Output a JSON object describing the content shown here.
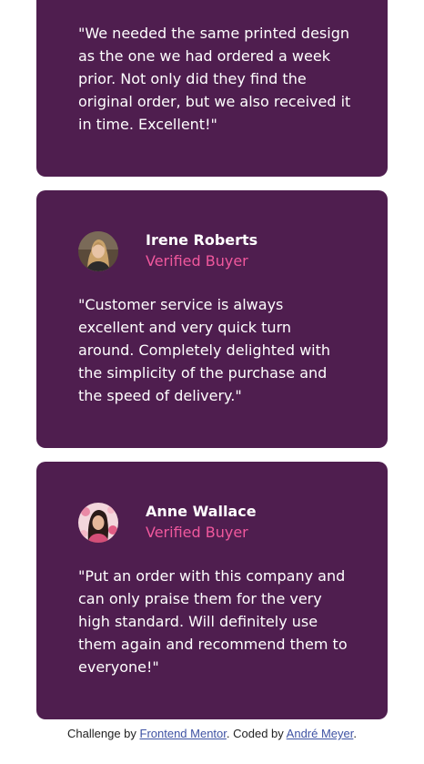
{
  "colors": {
    "card_background": "#4f1e4f",
    "accent": "#f0589d",
    "link": "#3e52a3"
  },
  "testimonials": [
    {
      "quote": "\"We needed the same printed design as the one we had ordered a week prior. Not only did they find the original order, but we also received it in time. Excellent!\""
    },
    {
      "name": "Irene Roberts",
      "role": "Verified Buyer",
      "quote": "\"Customer service is always excellent and very quick turn around. Completely delighted with the simplicity of the purchase and the speed of delivery.\""
    },
    {
      "name": "Anne Wallace",
      "role": "Verified Buyer",
      "quote": "\"Put an order with this company and can only praise them for the very high standard. Will definitely use them again and recommend them to everyone!\""
    }
  ],
  "footer": {
    "prefix": "Challenge by ",
    "challenge_link": "Frontend Mentor",
    "middle": ". Coded by ",
    "author_link": "André Meyer",
    "suffix": "."
  }
}
